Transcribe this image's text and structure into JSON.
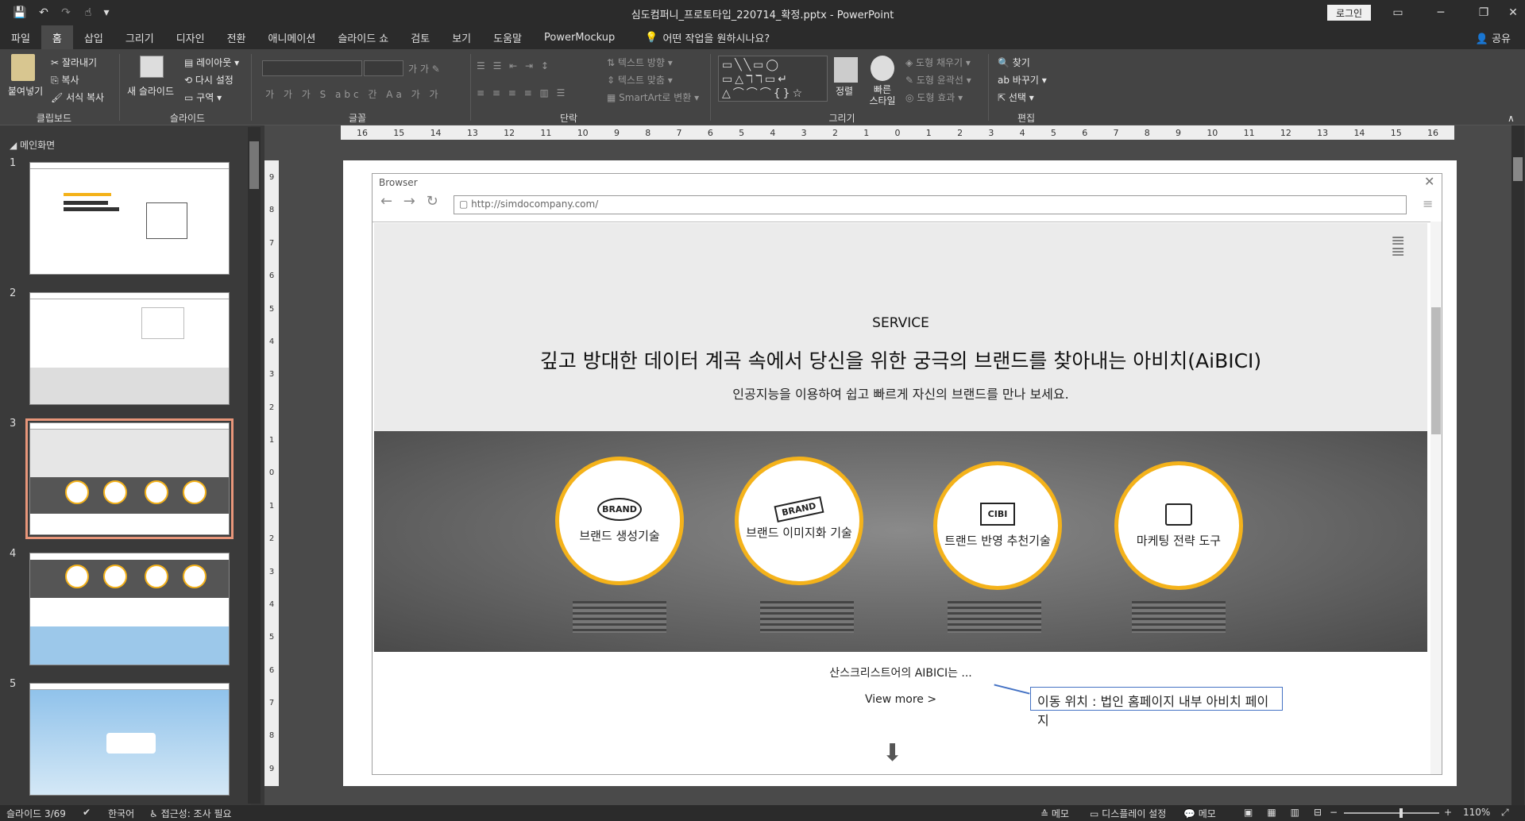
{
  "window": {
    "title": "심도컴퍼니_프로토타입_220714_확정.pptx  -  PowerPoint",
    "login": "로그인"
  },
  "qat": {
    "save": "💾",
    "undo": "↶",
    "redo": "↷",
    "customize": "▾"
  },
  "tabs": [
    "파일",
    "홈",
    "삽입",
    "그리기",
    "디자인",
    "전환",
    "애니메이션",
    "슬라이드 쇼",
    "검토",
    "보기",
    "도움말",
    "PowerMockup"
  ],
  "tell_me": "어떤 작업을 원하시나요?",
  "share": "공유",
  "ribbon": {
    "clipboard": {
      "paste": "붙여넣기",
      "cut": "잘라내기",
      "copy": "복사",
      "format_painter": "서식 복사",
      "label": "클립보드"
    },
    "slides": {
      "new_slide": "새 슬라이드",
      "layout": "레이아웃",
      "reset": "다시 설정",
      "section": "구역",
      "label": "슬라이드"
    },
    "font": {
      "label": "글꼴"
    },
    "paragraph": {
      "text_direction": "텍스트 방향",
      "align_text": "텍스트 맞춤",
      "smartart": "SmartArt로 변환",
      "label": "단락"
    },
    "drawing": {
      "arrange": "정렬",
      "quick_styles": "빠른 스타일",
      "shape_fill": "도형 채우기",
      "shape_outline": "도형 윤곽선",
      "shape_effects": "도형 효과",
      "label": "그리기"
    },
    "editing": {
      "find": "찾기",
      "replace": "바꾸기",
      "select": "선택",
      "label": "편집"
    }
  },
  "pane": {
    "section": "메인화면",
    "slides": [
      "1",
      "2",
      "3",
      "4",
      "5"
    ],
    "selected": 3
  },
  "ruler": {
    "h": [
      "16",
      "15",
      "14",
      "13",
      "12",
      "11",
      "10",
      "9",
      "8",
      "7",
      "6",
      "5",
      "4",
      "3",
      "2",
      "1",
      "0",
      "1",
      "2",
      "3",
      "4",
      "5",
      "6",
      "7",
      "8",
      "9",
      "10",
      "11",
      "12",
      "13",
      "14",
      "15",
      "16"
    ],
    "v": [
      "9",
      "8",
      "7",
      "6",
      "5",
      "4",
      "3",
      "2",
      "1",
      "0",
      "1",
      "2",
      "3",
      "4",
      "5",
      "6",
      "7",
      "8",
      "9"
    ]
  },
  "slide": {
    "browser_label": "Browser",
    "url": "http://simdocompany.com/",
    "service": "SERVICE",
    "headline": "깊고 방대한 데이터 계곡 속에서 당신을 위한 궁극의 브랜드를 찾아내는 아비치(AiBICI)",
    "subline": "인공지능을 이용하여 쉽고 빠르게 자신의 브랜드를 만나 보세요.",
    "features": [
      {
        "label": "브랜드 생성기술",
        "icon": "BRAND"
      },
      {
        "label": "브랜드 이미지화 기술",
        "icon": "BRAND"
      },
      {
        "label": "트랜드 반영 추천기술",
        "icon": "CIBI"
      },
      {
        "label": "마케팅 전략 도구",
        "icon": ""
      }
    ],
    "about": "산스크리스트어의 AIBICI는 ...",
    "view_more": "View more >",
    "callout": "이동 위치 : 법인 홈페이지 내부 아비치 페이지"
  },
  "status": {
    "slide": "슬라이드 3/69",
    "lang": "한국어",
    "accessibility": "접근성: 조사 필요",
    "notes": "메모",
    "display": "디스플레이 설정",
    "comments": "메모",
    "zoom": "110%"
  },
  "colors": {
    "accent": "#f4b21a",
    "selection": "#e8967a"
  }
}
